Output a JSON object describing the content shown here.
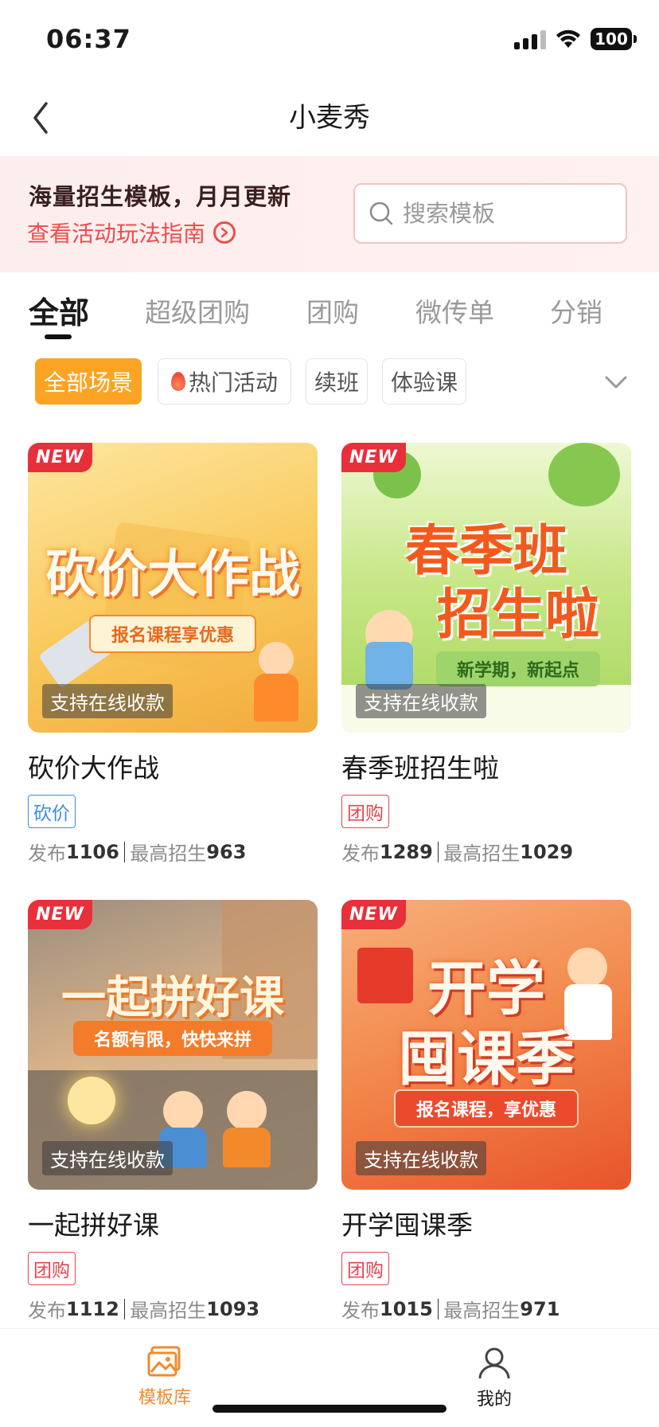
{
  "status_bar": {
    "time": "06:37",
    "battery": "100"
  },
  "nav": {
    "title": "小麦秀"
  },
  "banner": {
    "title": "海量招生模板，月月更新",
    "link": "查看活动玩法指南",
    "search_placeholder": "搜索模板"
  },
  "tabs": [
    {
      "label": "全部",
      "active": true
    },
    {
      "label": "超级团购"
    },
    {
      "label": "团购"
    },
    {
      "label": "微传单"
    },
    {
      "label": "分销"
    }
  ],
  "filters": [
    {
      "label": "全部场景",
      "active": true
    },
    {
      "label": "热门活动",
      "icon": "flame-icon"
    },
    {
      "label": "续班"
    },
    {
      "label": "体验课"
    }
  ],
  "cards": [
    {
      "badge": "NEW",
      "poster_title": "砍价大作战",
      "poster_sub": "报名课程享优惠",
      "pay_tag": "支持在线收款",
      "title": "砍价大作战",
      "tag": "砍价",
      "publish_label": "发布",
      "publish": "1106",
      "max_label": "最高招生",
      "max": "963"
    },
    {
      "badge": "NEW",
      "poster_title_1": "春季班",
      "poster_title_2": "招生啦",
      "poster_sub": "新学期，新起点",
      "pay_tag": "支持在线收款",
      "title": "春季班招生啦",
      "tag": "团购",
      "publish_label": "发布",
      "publish": "1289",
      "max_label": "最高招生",
      "max": "1029"
    },
    {
      "badge": "NEW",
      "poster_title": "一起拼好课",
      "poster_sub": "名额有限，快快来拼",
      "pay_tag": "支持在线收款",
      "title": "一起拼好课",
      "tag": "团购",
      "publish_label": "发布",
      "publish": "1112",
      "max_label": "最高招生",
      "max": "1093"
    },
    {
      "badge": "NEW",
      "poster_title_1": "开学",
      "poster_title_2": "囤课季",
      "poster_sub": "报名课程，享优惠",
      "pay_tag": "支持在线收款",
      "title": "开学囤课季",
      "tag": "团购",
      "publish_label": "发布",
      "publish": "1015",
      "max_label": "最高招生",
      "max": "971"
    }
  ],
  "tabbar": [
    {
      "label": "模板库",
      "active": true,
      "icon": "image-gallery-icon"
    },
    {
      "label": "我的",
      "icon": "user-icon"
    }
  ],
  "colors": {
    "accent": "#fba424",
    "red": "#e8454d",
    "blue": "#3a8ee6"
  }
}
